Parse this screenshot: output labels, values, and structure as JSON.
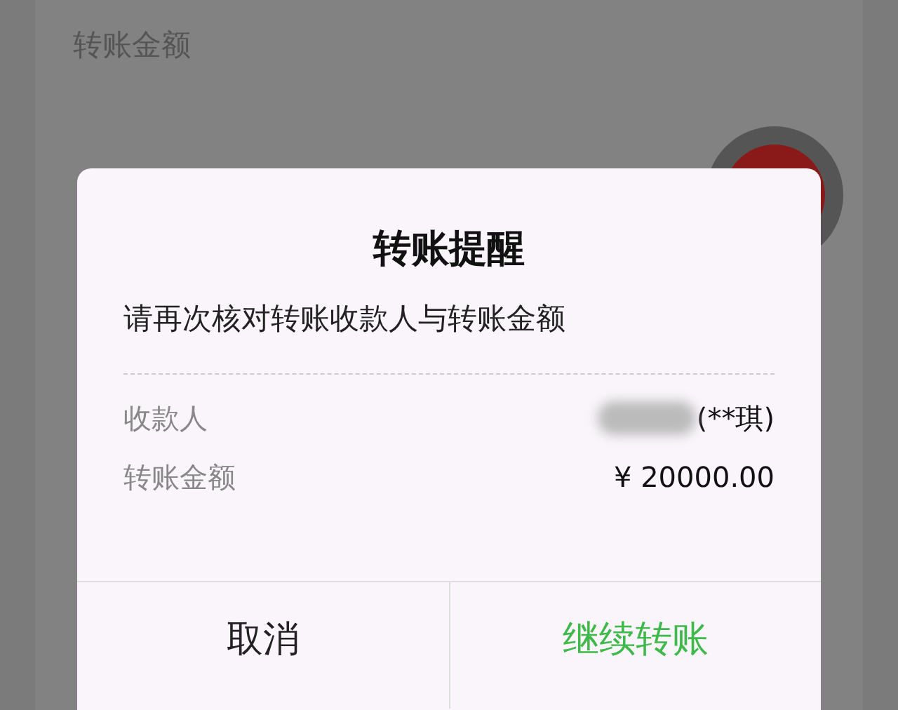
{
  "page": {
    "amount_label": "转账金额"
  },
  "dialog": {
    "title": "转账提醒",
    "message": "请再次核对转账收款人与转账金额",
    "rows": [
      {
        "label": "收款人",
        "value": "(**琪)",
        "kind": "masked"
      },
      {
        "label": "转账金额",
        "value": "¥ 20000.00",
        "kind": "plain"
      }
    ],
    "buttons": [
      {
        "label": "取消",
        "kind": "cancel"
      },
      {
        "label": "继续转账",
        "kind": "confirm"
      }
    ]
  }
}
